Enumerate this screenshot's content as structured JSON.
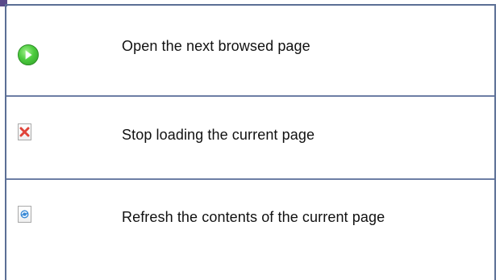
{
  "rows": [
    {
      "icon": "next-page-icon",
      "label": "Open the next browsed page"
    },
    {
      "icon": "stop-loading-icon",
      "label": "Stop loading the current page"
    },
    {
      "icon": "refresh-page-icon",
      "label": "Refresh the contents of the current page"
    }
  ],
  "colors": {
    "border": "#5b6f95",
    "go_green": "#4ccb3e",
    "stop_red": "#e0443a",
    "refresh_blue": "#3a8ad6"
  }
}
